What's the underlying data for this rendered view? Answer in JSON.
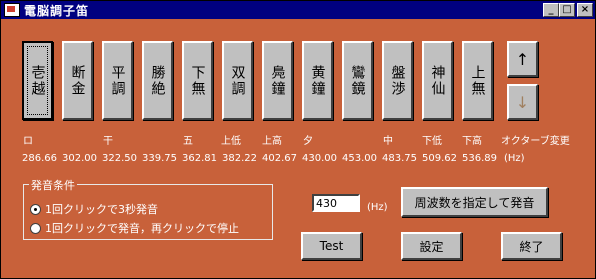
{
  "window": {
    "title": "電脳調子笛",
    "controls": {
      "minimize": "_",
      "maximize": "□",
      "close": "×"
    }
  },
  "notes": [
    {
      "label": "壱越",
      "tone_label": "ロ",
      "freq": "286.66"
    },
    {
      "label": "断金",
      "tone_label": "",
      "freq": "302.00"
    },
    {
      "label": "平調",
      "tone_label": "干",
      "freq": "322.50"
    },
    {
      "label": "勝絶",
      "tone_label": "",
      "freq": "339.75"
    },
    {
      "label": "下無",
      "tone_label": "五",
      "freq": "362.81"
    },
    {
      "label": "双調",
      "tone_label": "上低",
      "freq": "382.22"
    },
    {
      "label": "鳧鐘",
      "tone_label": "上高",
      "freq": "402.67"
    },
    {
      "label": "黄鐘",
      "tone_label": "夕",
      "freq": "430.00"
    },
    {
      "label": "鸞鏡",
      "tone_label": "",
      "freq": "453.00"
    },
    {
      "label": "盤渉",
      "tone_label": "中",
      "freq": "483.75"
    },
    {
      "label": "神仙",
      "tone_label": "下低",
      "freq": "509.62"
    },
    {
      "label": "上無",
      "tone_label": "下高",
      "freq": "536.89"
    }
  ],
  "octave": {
    "up": "↑",
    "down": "↓",
    "label": "オクターブ変更",
    "unit": "(Hz)"
  },
  "sound_condition": {
    "legend": "発音条件",
    "options": [
      {
        "label": "1回クリックで3秒発音",
        "selected": true
      },
      {
        "label": "1回クリックで発音，再クリックで停止",
        "selected": false
      }
    ]
  },
  "frequency": {
    "value": "430",
    "unit": "(Hz)",
    "play_button": "周波数を指定して発音"
  },
  "buttons": {
    "test": "Test",
    "settings": "設定",
    "exit": "終了"
  }
}
